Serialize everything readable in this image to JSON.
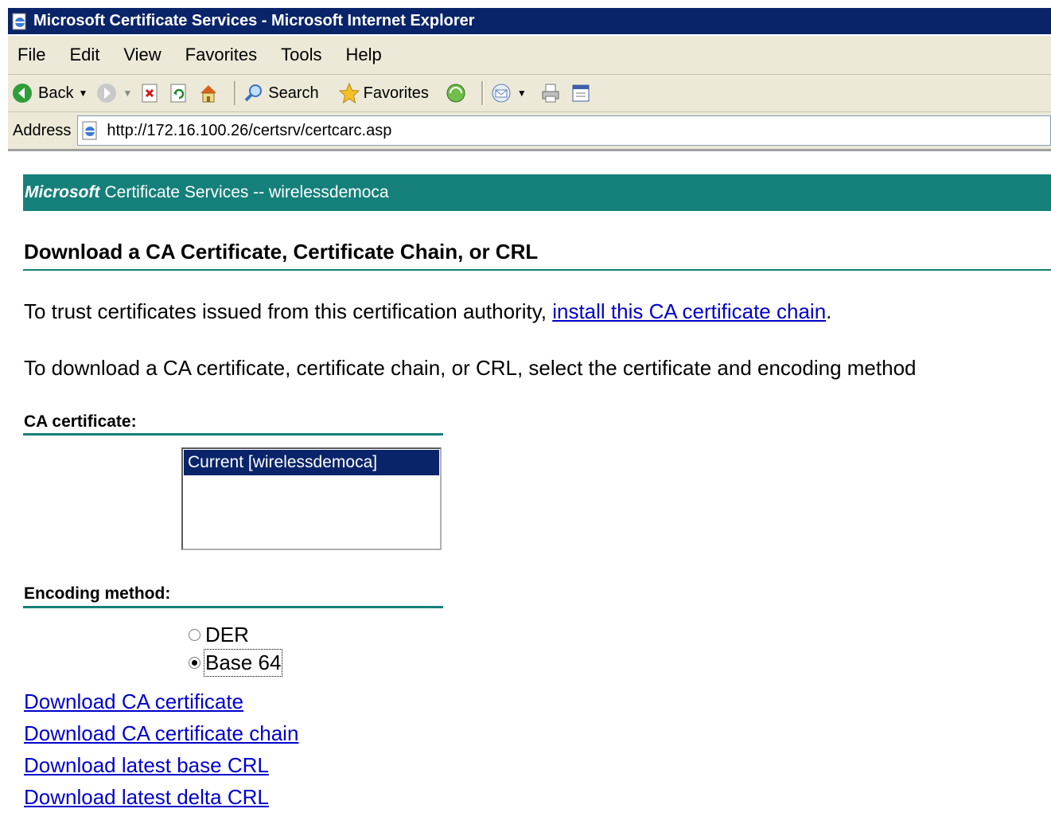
{
  "window": {
    "title": "Microsoft Certificate Services - Microsoft Internet Explorer"
  },
  "menu": {
    "items": [
      "File",
      "Edit",
      "View",
      "Favorites",
      "Tools",
      "Help"
    ]
  },
  "toolbar": {
    "back_label": "Back",
    "search_label": "Search",
    "favorites_label": "Favorites"
  },
  "address": {
    "label": "Address",
    "url": "http://172.16.100.26/certsrv/certcarc.asp"
  },
  "page": {
    "banner_brand": "Microsoft",
    "banner_text": "Certificate Services  --  wirelessdemoca",
    "heading": "Download a CA Certificate, Certificate Chain, or CRL",
    "para1_text": "To trust certificates issued from this certification authority, ",
    "para1_link": "install this CA certificate chain",
    "para1_end": ".",
    "para2_text": "To download a CA certificate, certificate chain, or CRL, select the certificate and encoding method",
    "ca_label": "CA certificate:",
    "ca_options": [
      "Current [wirelessdemoca]"
    ],
    "encoding_label": "Encoding method:",
    "encoding_options": [
      {
        "label": "DER",
        "checked": false
      },
      {
        "label": "Base 64",
        "checked": true
      }
    ],
    "links": [
      "Download CA certificate",
      "Download CA certificate chain",
      "Download latest base CRL",
      "Download latest delta CRL"
    ]
  }
}
